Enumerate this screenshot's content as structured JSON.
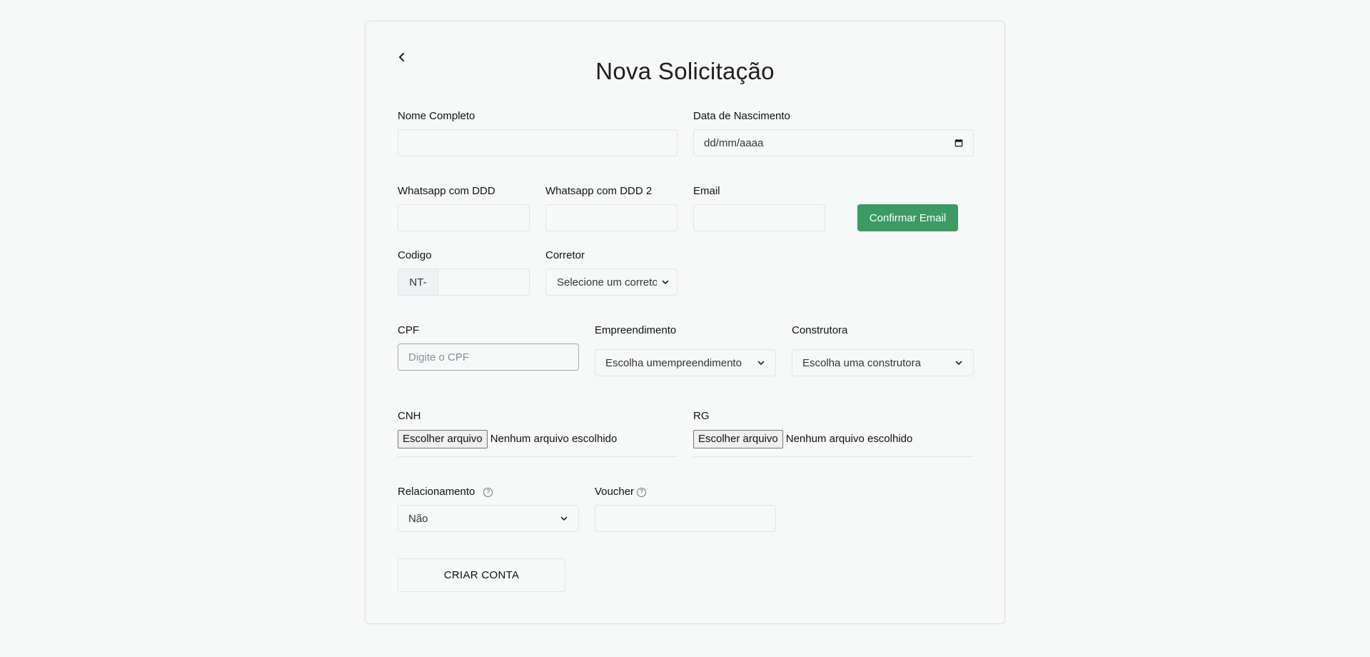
{
  "page": {
    "title": "Nova Solicitação"
  },
  "fields": {
    "nome": {
      "label": "Nome Completo",
      "value": ""
    },
    "nascimento": {
      "label": "Data de Nascimento",
      "value": "dd/mm/aaaa"
    },
    "whatsapp": {
      "label": "Whatsapp com DDD",
      "value": ""
    },
    "whatsapp2": {
      "label": "Whatsapp com DDD 2",
      "value": ""
    },
    "email": {
      "label": "Email",
      "value": ""
    },
    "confirmar_email": {
      "label": "Confirmar Email"
    },
    "codigo": {
      "label": "Codigo",
      "prefix": "NT-",
      "value": ""
    },
    "corretor": {
      "label": "Corretor",
      "selected": "Selecione um correto"
    },
    "cpf": {
      "label": "CPF",
      "placeholder": "Digite o CPF"
    },
    "empreendimento": {
      "label": "Empreendimento",
      "selected": "Escolha umempreendimento"
    },
    "construtora": {
      "label": "Construtora",
      "selected": "Escolha uma construtora"
    },
    "cnh": {
      "label": "CNH",
      "button": "Escolher arquivo",
      "status": "Nenhum arquivo escolhido"
    },
    "rg": {
      "label": "RG",
      "button": "Escolher arquivo",
      "status": "Nenhum arquivo escolhido"
    },
    "relacionamento": {
      "label": "Relacionamento",
      "selected": "Não",
      "help": "?"
    },
    "voucher": {
      "label": "Voucher",
      "value": "",
      "help": "?"
    }
  },
  "actions": {
    "submit": "CRIAR CONTA"
  },
  "colors": {
    "accent": "#3c9a64",
    "background": "#f7f8f8",
    "border": "#e2e4e7"
  },
  "icons": {
    "back": "chevron-left-icon",
    "calendar": "calendar-icon",
    "dropdown": "chevron-down-icon",
    "help": "help-circle-icon"
  }
}
